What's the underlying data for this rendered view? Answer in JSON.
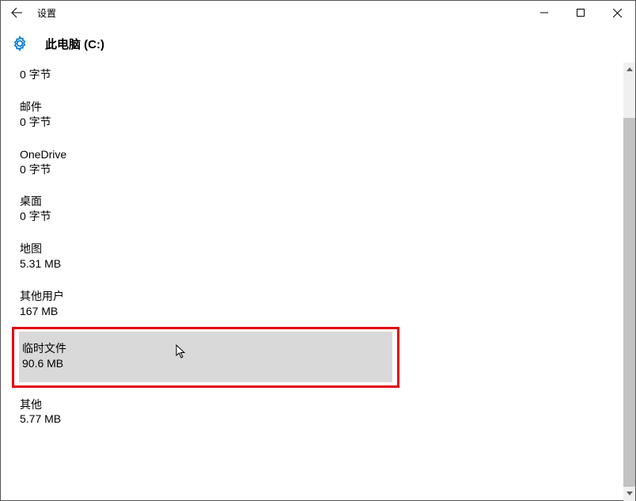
{
  "window": {
    "title": "设置"
  },
  "header": {
    "page_title": "此电脑 (C:)"
  },
  "items": [
    {
      "label": "",
      "size": "0 字节"
    },
    {
      "label": "邮件",
      "size": "0 字节"
    },
    {
      "label": "OneDrive",
      "size": "0 字节"
    },
    {
      "label": "桌面",
      "size": "0 字节"
    },
    {
      "label": "地图",
      "size": "5.31 MB"
    },
    {
      "label": "其他用户",
      "size": "167 MB"
    },
    {
      "label": "临时文件",
      "size": "90.6 MB"
    },
    {
      "label": "其他",
      "size": "5.77 MB"
    }
  ]
}
